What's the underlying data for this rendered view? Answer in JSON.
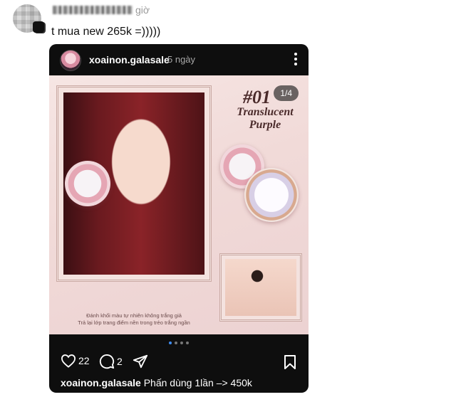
{
  "comment": {
    "time_ago": "giờ",
    "text": "t mua new 265k =)))))"
  },
  "post": {
    "username": "xoainon.galasale",
    "time_ago": "5 ngày",
    "slide_counter": "1/4",
    "image": {
      "shade_code": "#01",
      "shade_name_line1": "Translucent",
      "shade_name_line2": "Purple",
      "caption_line1": "Đánh khối màu tự nhiên không trắng giả",
      "caption_line2": "Trả lại lớp trang điểm nền trong trẻo trắng ngần"
    },
    "carousel_dots": 4,
    "active_dot": 1,
    "likes": "22",
    "comments": "2",
    "caption_username": "xoainon.galasale",
    "caption_text": "Phấn dùng 1lần –> 450k"
  }
}
